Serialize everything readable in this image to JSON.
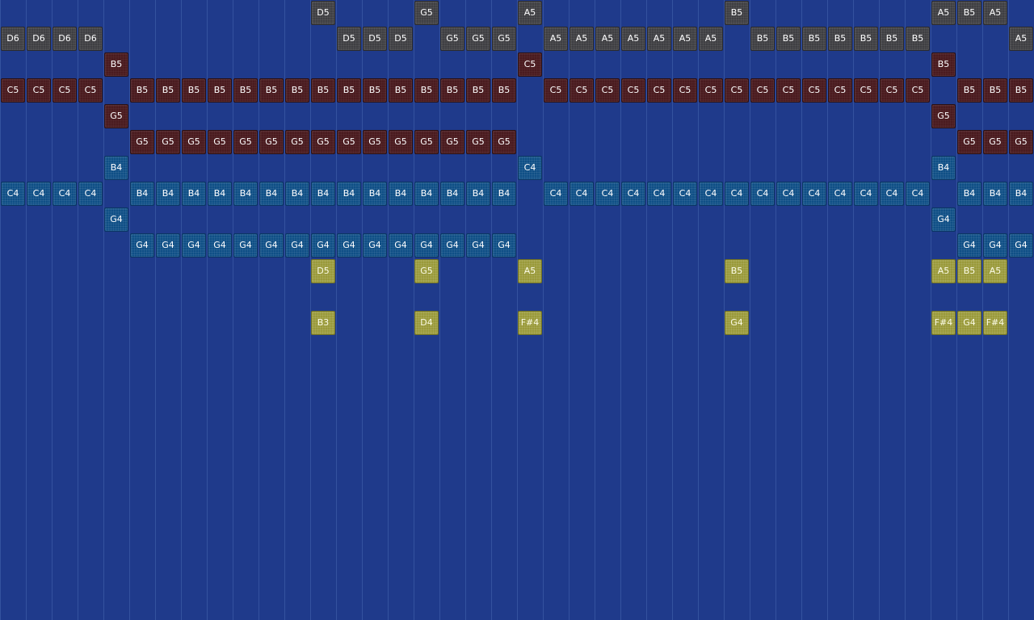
{
  "colors": {
    "background": "#1f3a8b",
    "gridline": "#34529f",
    "gray": "#3f3f43",
    "red": "#4a1b1f",
    "blue": "#0f4f86",
    "yellow": "#9a9a3a"
  },
  "rows": [
    {
      "row": 0,
      "color": "gray",
      "cells": [
        [
          12,
          "D5"
        ],
        [
          16,
          "G5"
        ],
        [
          20,
          "A5"
        ],
        [
          28,
          "B5"
        ],
        [
          36,
          "A5"
        ],
        [
          37,
          "B5"
        ],
        [
          38,
          "A5"
        ]
      ]
    },
    {
      "row": 1,
      "color": "gray",
      "cells": [
        [
          0,
          "D6"
        ],
        [
          1,
          "D6"
        ],
        [
          2,
          "D6"
        ],
        [
          3,
          "D6"
        ],
        [
          13,
          "D5"
        ],
        [
          14,
          "D5"
        ],
        [
          15,
          "D5"
        ],
        [
          17,
          "G5"
        ],
        [
          18,
          "G5"
        ],
        [
          19,
          "G5"
        ],
        [
          21,
          "A5"
        ],
        [
          22,
          "A5"
        ],
        [
          23,
          "A5"
        ],
        [
          24,
          "A5"
        ],
        [
          25,
          "A5"
        ],
        [
          26,
          "A5"
        ],
        [
          27,
          "A5"
        ],
        [
          29,
          "B5"
        ],
        [
          30,
          "B5"
        ],
        [
          31,
          "B5"
        ],
        [
          32,
          "B5"
        ],
        [
          33,
          "B5"
        ],
        [
          34,
          "B5"
        ],
        [
          35,
          "B5"
        ],
        [
          39,
          "A5"
        ]
      ]
    },
    {
      "row": 2,
      "color": "red",
      "cells": [
        [
          4,
          "B5"
        ],
        [
          20,
          "C5"
        ],
        [
          36,
          "B5"
        ]
      ]
    },
    {
      "row": 3,
      "color": "red",
      "cells": [
        [
          0,
          "C5"
        ],
        [
          1,
          "C5"
        ],
        [
          2,
          "C5"
        ],
        [
          3,
          "C5"
        ],
        [
          5,
          "B5"
        ],
        [
          6,
          "B5"
        ],
        [
          7,
          "B5"
        ],
        [
          8,
          "B5"
        ],
        [
          9,
          "B5"
        ],
        [
          10,
          "B5"
        ],
        [
          11,
          "B5"
        ],
        [
          12,
          "B5"
        ],
        [
          13,
          "B5"
        ],
        [
          14,
          "B5"
        ],
        [
          15,
          "B5"
        ],
        [
          16,
          "B5"
        ],
        [
          17,
          "B5"
        ],
        [
          18,
          "B5"
        ],
        [
          19,
          "B5"
        ],
        [
          21,
          "C5"
        ],
        [
          22,
          "C5"
        ],
        [
          23,
          "C5"
        ],
        [
          24,
          "C5"
        ],
        [
          25,
          "C5"
        ],
        [
          26,
          "C5"
        ],
        [
          27,
          "C5"
        ],
        [
          28,
          "C5"
        ],
        [
          29,
          "C5"
        ],
        [
          30,
          "C5"
        ],
        [
          31,
          "C5"
        ],
        [
          32,
          "C5"
        ],
        [
          33,
          "C5"
        ],
        [
          34,
          "C5"
        ],
        [
          35,
          "C5"
        ],
        [
          37,
          "B5"
        ],
        [
          38,
          "B5"
        ],
        [
          39,
          "B5"
        ]
      ]
    },
    {
      "row": 4,
      "color": "red",
      "cells": [
        [
          4,
          "G5"
        ],
        [
          36,
          "G5"
        ]
      ]
    },
    {
      "row": 5,
      "color": "red",
      "cells": [
        [
          5,
          "G5"
        ],
        [
          6,
          "G5"
        ],
        [
          7,
          "G5"
        ],
        [
          8,
          "G5"
        ],
        [
          9,
          "G5"
        ],
        [
          10,
          "G5"
        ],
        [
          11,
          "G5"
        ],
        [
          12,
          "G5"
        ],
        [
          13,
          "G5"
        ],
        [
          14,
          "G5"
        ],
        [
          15,
          "G5"
        ],
        [
          16,
          "G5"
        ],
        [
          17,
          "G5"
        ],
        [
          18,
          "G5"
        ],
        [
          19,
          "G5"
        ],
        [
          37,
          "G5"
        ],
        [
          38,
          "G5"
        ],
        [
          39,
          "G5"
        ]
      ]
    },
    {
      "row": 6,
      "color": "blue",
      "cells": [
        [
          4,
          "B4"
        ],
        [
          20,
          "C4"
        ],
        [
          36,
          "B4"
        ]
      ]
    },
    {
      "row": 7,
      "color": "blue",
      "cells": [
        [
          0,
          "C4"
        ],
        [
          1,
          "C4"
        ],
        [
          2,
          "C4"
        ],
        [
          3,
          "C4"
        ],
        [
          5,
          "B4"
        ],
        [
          6,
          "B4"
        ],
        [
          7,
          "B4"
        ],
        [
          8,
          "B4"
        ],
        [
          9,
          "B4"
        ],
        [
          10,
          "B4"
        ],
        [
          11,
          "B4"
        ],
        [
          12,
          "B4"
        ],
        [
          13,
          "B4"
        ],
        [
          14,
          "B4"
        ],
        [
          15,
          "B4"
        ],
        [
          16,
          "B4"
        ],
        [
          17,
          "B4"
        ],
        [
          18,
          "B4"
        ],
        [
          19,
          "B4"
        ],
        [
          21,
          "C4"
        ],
        [
          22,
          "C4"
        ],
        [
          23,
          "C4"
        ],
        [
          24,
          "C4"
        ],
        [
          25,
          "C4"
        ],
        [
          26,
          "C4"
        ],
        [
          27,
          "C4"
        ],
        [
          28,
          "C4"
        ],
        [
          29,
          "C4"
        ],
        [
          30,
          "C4"
        ],
        [
          31,
          "C4"
        ],
        [
          32,
          "C4"
        ],
        [
          33,
          "C4"
        ],
        [
          34,
          "C4"
        ],
        [
          35,
          "C4"
        ],
        [
          37,
          "B4"
        ],
        [
          38,
          "B4"
        ],
        [
          39,
          "B4"
        ]
      ]
    },
    {
      "row": 8,
      "color": "blue",
      "cells": [
        [
          4,
          "G4"
        ],
        [
          36,
          "G4"
        ]
      ]
    },
    {
      "row": 9,
      "color": "blue",
      "cells": [
        [
          5,
          "G4"
        ],
        [
          6,
          "G4"
        ],
        [
          7,
          "G4"
        ],
        [
          8,
          "G4"
        ],
        [
          9,
          "G4"
        ],
        [
          10,
          "G4"
        ],
        [
          11,
          "G4"
        ],
        [
          12,
          "G4"
        ],
        [
          13,
          "G4"
        ],
        [
          14,
          "G4"
        ],
        [
          15,
          "G4"
        ],
        [
          16,
          "G4"
        ],
        [
          17,
          "G4"
        ],
        [
          18,
          "G4"
        ],
        [
          19,
          "G4"
        ],
        [
          37,
          "G4"
        ],
        [
          38,
          "G4"
        ],
        [
          39,
          "G4"
        ]
      ]
    },
    {
      "row": 10,
      "color": "yellow",
      "cells": [
        [
          12,
          "D5"
        ],
        [
          16,
          "G5"
        ],
        [
          20,
          "A5"
        ],
        [
          28,
          "B5"
        ],
        [
          36,
          "A5"
        ],
        [
          37,
          "B5"
        ],
        [
          38,
          "A5"
        ]
      ]
    },
    {
      "row": 12,
      "color": "yellow",
      "cells": [
        [
          12,
          "B3"
        ],
        [
          16,
          "D4"
        ],
        [
          20,
          "F#4"
        ],
        [
          28,
          "G4"
        ],
        [
          36,
          "F#4"
        ],
        [
          37,
          "G4"
        ],
        [
          38,
          "F#4"
        ]
      ]
    }
  ]
}
